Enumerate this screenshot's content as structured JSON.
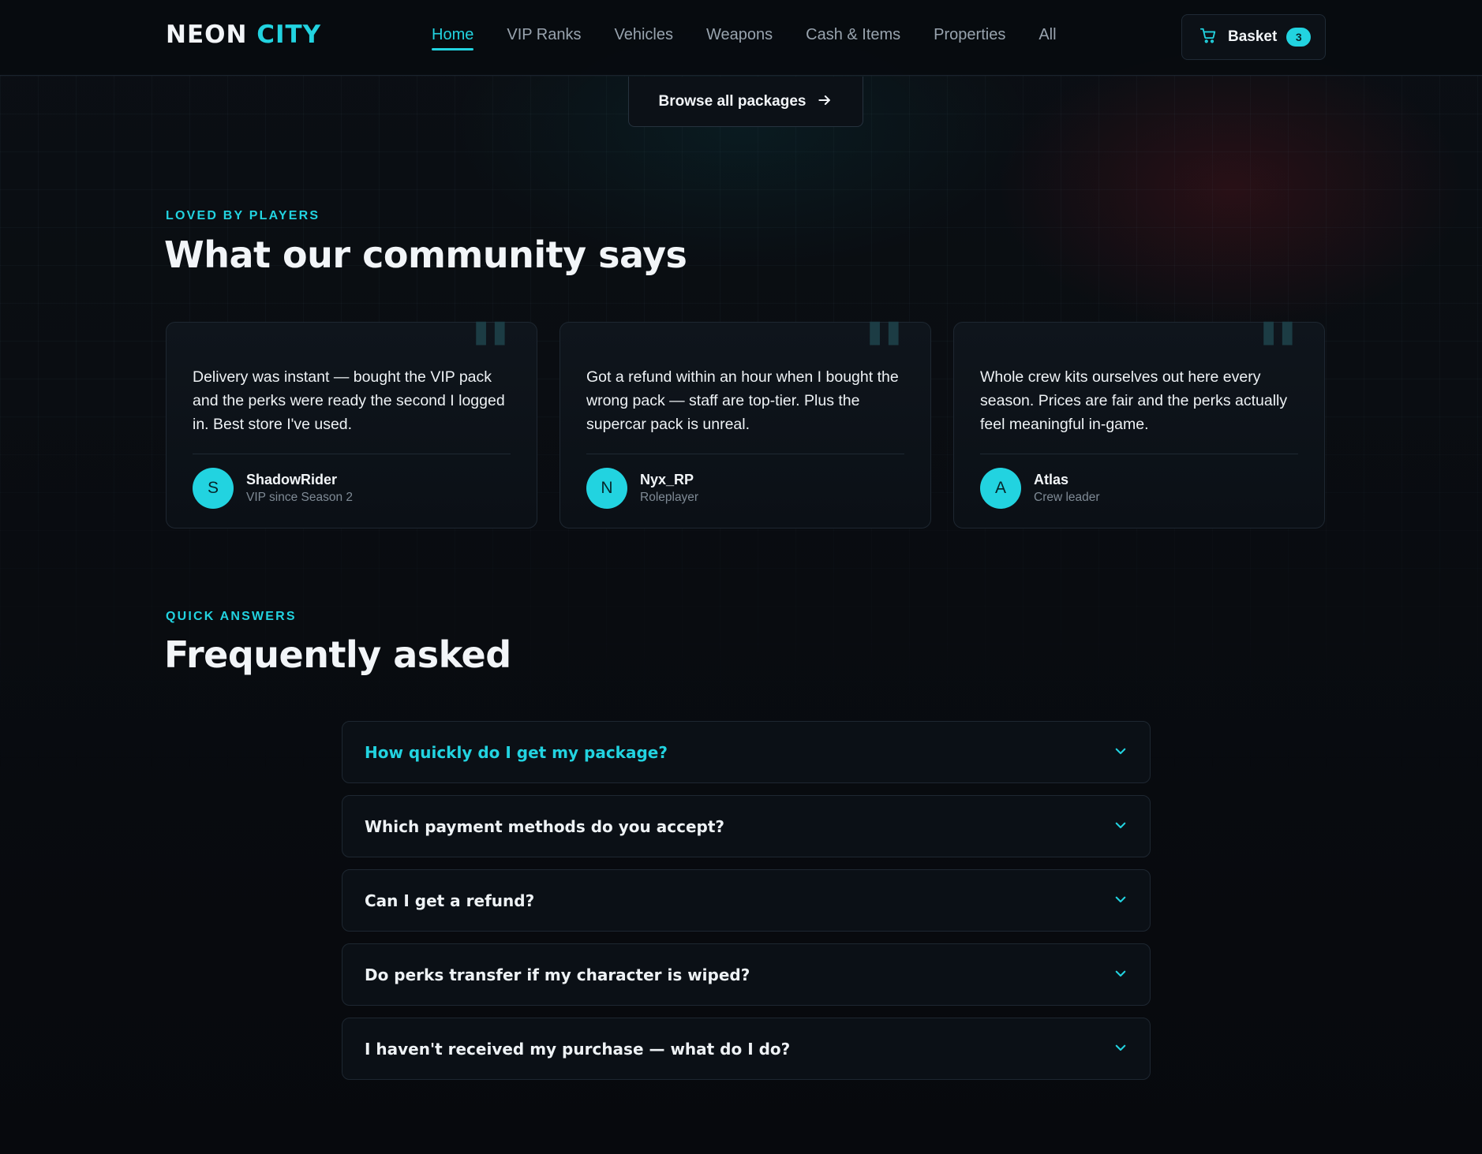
{
  "brand": {
    "name_part1": "NEON",
    "name_part2": "CITY",
    "accent": "#22d3e0"
  },
  "nav": {
    "links": [
      {
        "label": "Home",
        "active": true
      },
      {
        "label": "VIP Ranks"
      },
      {
        "label": "Vehicles"
      },
      {
        "label": "Weapons"
      },
      {
        "label": "Cash & Items"
      },
      {
        "label": "Properties"
      },
      {
        "label": "All"
      }
    ],
    "basket": {
      "label": "Basket",
      "count": "3",
      "icon": "cart-icon"
    }
  },
  "browse": {
    "label": "Browse all packages",
    "icon": "arrow-right-icon"
  },
  "testimonials": {
    "eyebrow": "LOVED BY PLAYERS",
    "title": "What our community says",
    "items": [
      {
        "text": "Delivery was instant — bought the VIP pack and the perks were ready the second I logged in. Best store I've used.",
        "initial": "S",
        "name": "ShadowRider",
        "role": "VIP since Season 2"
      },
      {
        "text": "Got a refund within an hour when I bought the wrong pack — staff are top-tier. Plus the supercar pack is unreal.",
        "initial": "N",
        "name": "Nyx_RP",
        "role": "Roleplayer"
      },
      {
        "text": "Whole crew kits ourselves out here every season. Prices are fair and the perks actually feel meaningful in-game.",
        "initial": "A",
        "name": "Atlas",
        "role": "Crew leader"
      }
    ],
    "quote_glyph": "\""
  },
  "faq": {
    "eyebrow": "QUICK ANSWERS",
    "title": "Frequently asked",
    "items": [
      {
        "question": "How quickly do I get my package?",
        "open": true
      },
      {
        "question": "Which payment methods do you accept?"
      },
      {
        "question": "Can I get a refund?"
      },
      {
        "question": "Do perks transfer if my character is wiped?"
      },
      {
        "question": "I haven't received my purchase — what do I do?"
      }
    ],
    "icon": "chevron-down-icon"
  }
}
